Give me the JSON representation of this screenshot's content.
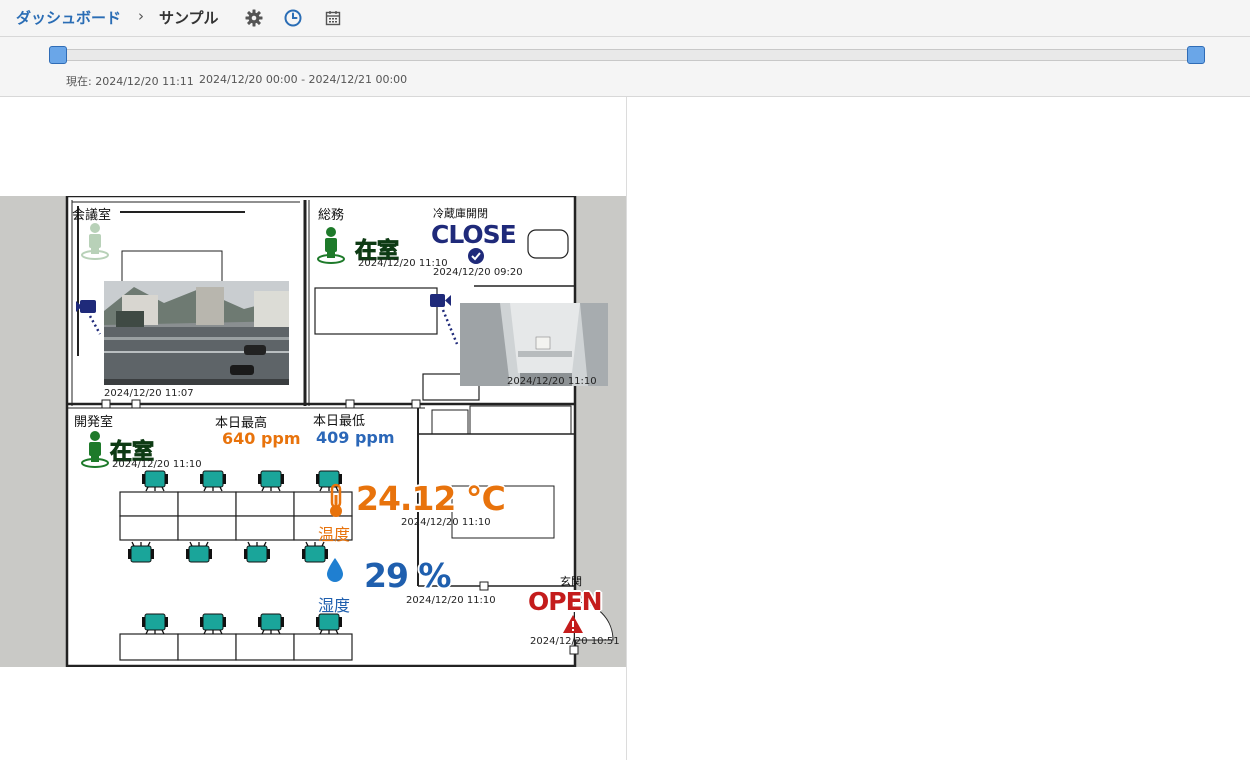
{
  "header": {
    "breadcrumb_parent": "ダッシュボード",
    "breadcrumb_separator": "›",
    "breadcrumb_current": "サンプル",
    "icons": [
      "gear-icon",
      "clock-icon",
      "calendar-icon"
    ]
  },
  "timeline": {
    "current_label": "現在: 2024/12/20 11:11",
    "range_label": "2024/12/20 00:00 - 2024/12/21 00:00",
    "start_handle": 0,
    "end_handle": 1
  },
  "floor": {
    "meeting_room": {
      "label": "会議室",
      "camera_timestamp": "2024/12/20 11:07"
    },
    "general_affairs": {
      "label": "総務",
      "presence": "在室",
      "presence_timestamp": "2024/12/20 11:10"
    },
    "fridge": {
      "label": "冷蔵庫開閉",
      "state": "CLOSE",
      "timestamp": "2024/12/20 09:20",
      "camera_timestamp": "2024/12/20 11:10"
    },
    "dev_room": {
      "label": "開発室",
      "presence": "在室",
      "presence_timestamp": "2024/12/20 11:10"
    },
    "co2": {
      "max_label": "本日最高",
      "max_value": "640 ppm",
      "min_label": "本日最低",
      "min_value": "409 ppm"
    },
    "temperature": {
      "value": "24.12 ℃",
      "label": "温度",
      "timestamp": "2024/12/20 11:10"
    },
    "humidity": {
      "value": "29 %",
      "label": "湿度",
      "timestamp": "2024/12/20 11:10"
    },
    "entrance": {
      "label": "玄関",
      "state": "OPEN",
      "timestamp": "2024/12/20 10:51"
    }
  },
  "colors": {
    "accent_blue": "#2a6db5",
    "presence_green": "#1e7a2a",
    "close_navy": "#1f2a7a",
    "co2_max_orange": "#e8730c",
    "co2_min_blue": "#2b67b8",
    "temp_orange": "#e8730c",
    "humidity_blue": "#1f5fae",
    "open_red": "#c41c1c",
    "chair_teal": "#1aa59a"
  }
}
